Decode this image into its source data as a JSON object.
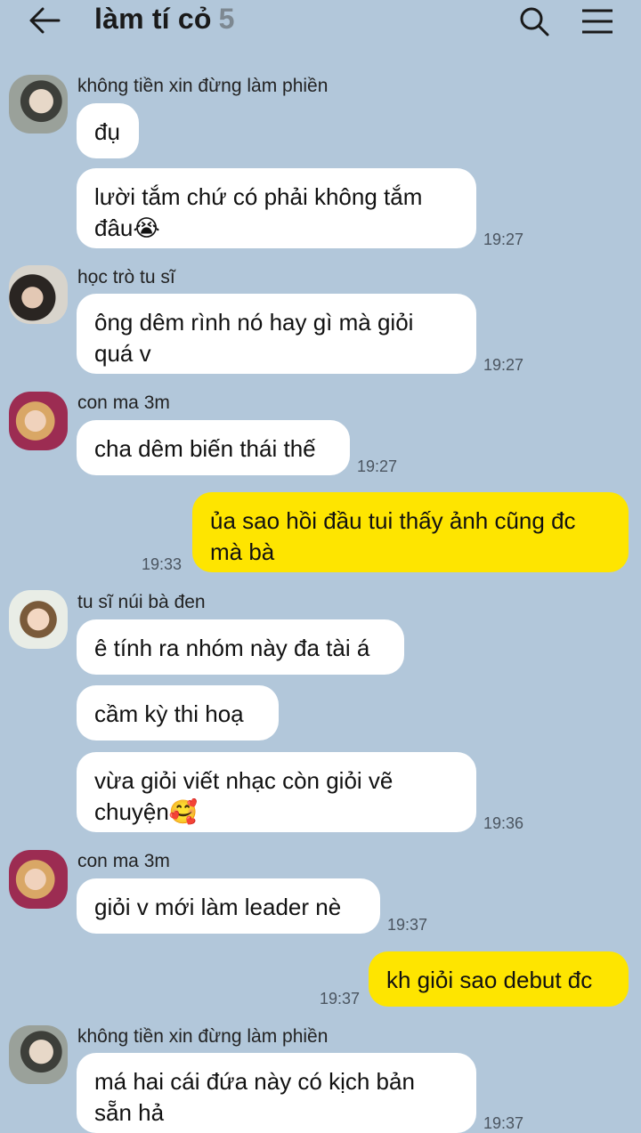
{
  "header": {
    "title": "làm tí cỏ",
    "member_count": "5",
    "back_icon": "arrow-left-icon",
    "search_icon": "search-icon",
    "menu_icon": "hamburger-menu-icon"
  },
  "colors": {
    "background": "#b2c7da",
    "incoming_bubble": "#ffffff",
    "outgoing_bubble": "#fee500"
  },
  "messages": {
    "g1": {
      "sender": "không tiền xin đừng làm phiền",
      "m1": "đụ",
      "m2_line1": "lười tắm chứ có phải không tắm",
      "m2_line2": "đâu😭",
      "time": "19:27"
    },
    "g2": {
      "sender": "học trò tu sĩ",
      "m1_line1": "ông dêm rình nó hay gì mà giỏi",
      "m1_line2": "quá v",
      "time": "19:27"
    },
    "g3": {
      "sender": "con ma 3m",
      "m1": "cha dêm biến thái thế",
      "time": "19:27"
    },
    "g4": {
      "m1_line1": "ủa sao hồi đầu tui thấy ảnh cũng đc",
      "m1_line2": "mà bà",
      "time": "19:33"
    },
    "g5": {
      "sender": "tu sĩ núi bà đen",
      "m1": "ê tính ra nhóm này đa tài á",
      "m2": "cầm kỳ thi hoạ",
      "m3_line1": "vừa giỏi viết nhạc còn giỏi vẽ",
      "m3_line2": "chuyện🥰",
      "time": "19:36"
    },
    "g6": {
      "sender": "con ma 3m",
      "m1": "giỏi v mới làm leader nè",
      "time": "19:37"
    },
    "g7": {
      "m1": "kh giỏi sao debut đc",
      "time": "19:37"
    },
    "g8": {
      "sender": "không tiền xin đừng làm phiền",
      "m1_line1": "má hai cái đứa này có kịch bản",
      "m1_line2": "sẵn hả",
      "time": "19:37"
    }
  }
}
